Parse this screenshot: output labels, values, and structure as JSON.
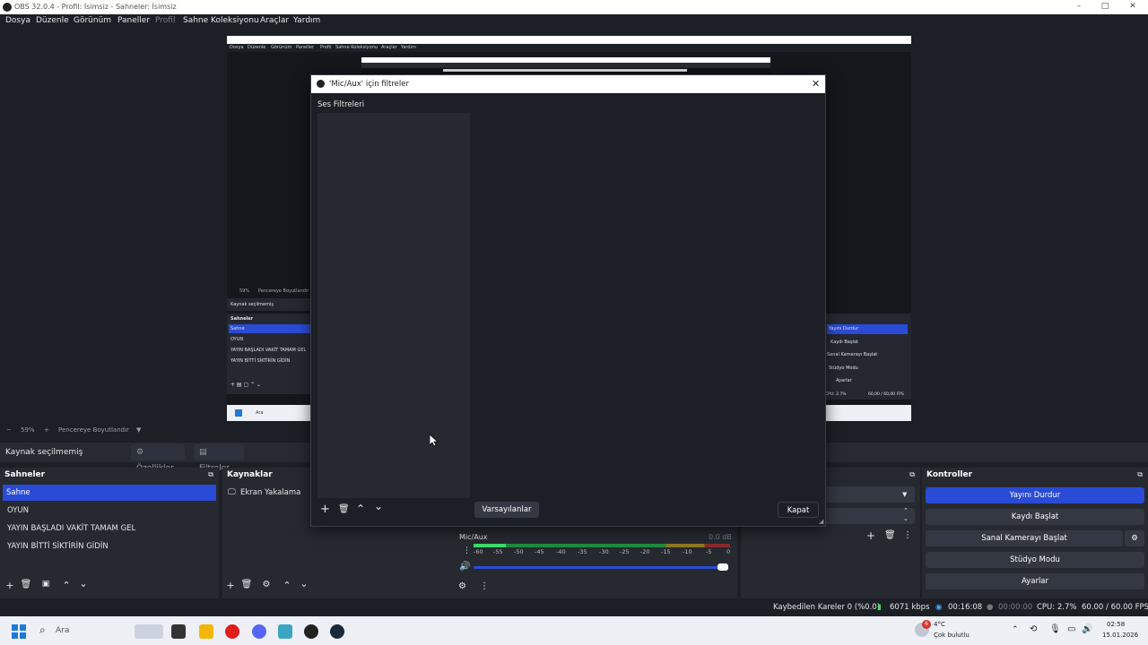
{
  "window": {
    "title": "OBS 32.0.4 - Profil: İsimsiz - Sahneler: İsimsiz"
  },
  "menu": [
    "Dosya",
    "Düzenle",
    "Görünüm",
    "Paneller",
    "Profil",
    "Sahne Koleksiyonu",
    "Araçlar",
    "Yardım"
  ],
  "preview": {
    "nested_menu": [
      "Dosya",
      "Düzenle",
      "Görünüm",
      "Paneller",
      "Profil",
      "Sahne Koleksiyonu",
      "Araçlar",
      "Yardım"
    ],
    "nested_zoom": "59%",
    "nested_fit": "Pencereye Boyutlandır",
    "nested_source": "Kaynak seçilmemiş",
    "nested_scenes_title": "Sahneler",
    "nested_scenes": [
      "Sahne",
      "OYUN",
      "YAYIN BAŞLADI VAKİT TAMAM GEL",
      "YAYIN BİTTİ SİKTİRİN GİDİN"
    ],
    "nested_controls": [
      "Yayını Durdur",
      "Kaydı Başlat",
      "Sanal Kamerayı Başlat",
      "Stüdyo Modu",
      "Ayarlar"
    ],
    "nested_status": "CPU: 2.7%",
    "nested_fps": "60,00 / 60,00 FPS",
    "nested_search": "Ara"
  },
  "zoom": {
    "minus": "−",
    "value": "59%",
    "plus": "+",
    "fit_label": "Pencereye Boyutlandır"
  },
  "context": {
    "no_source": "Kaynak seçilmemiş",
    "properties": "Özellikler",
    "filters": "Filtreler"
  },
  "scenes": {
    "title": "Sahneler",
    "items": [
      "Sahne",
      "OYUN",
      "YAYIN BAŞLADI VAKİT TAMAM GEL",
      "YAYIN BİTTİ SİKTİRİN GİDİN"
    ],
    "selected": 0
  },
  "sources": {
    "title": "Kaynaklar",
    "items": [
      "Ekran Yakalama"
    ]
  },
  "mixer": {
    "channel": "Mic/Aux",
    "db": "0.0 dB",
    "ticks": [
      "-60",
      "-55",
      "-50",
      "-45",
      "-40",
      "-35",
      "-30",
      "-25",
      "-20",
      "-15",
      "-10",
      "-5",
      "0"
    ],
    "volume": 1.0
  },
  "controls": {
    "title": "Kontroller",
    "buttons": [
      "Yayını Durdur",
      "Kaydı Başlat",
      "Sanal Kamerayı Başlat",
      "Stüdyo Modu",
      "Ayarlar"
    ]
  },
  "status": {
    "dropped": "Kaybedilen Kareler 0 (%0.0)",
    "bitrate": "6071 kbps",
    "stream_time": "00:16:08",
    "rec_time": "00:00:00",
    "cpu": "CPU: 2.7%",
    "fps": "60.00 / 60.00 FPS"
  },
  "dialog": {
    "title": "'Mic/Aux' için filtreler",
    "section": "Ses Filtreleri",
    "defaults_btn": "Varsayılanlar",
    "close_btn": "Kapat"
  },
  "taskbar": {
    "search": "Ara",
    "temp": "4°C",
    "weather": "Çok bulutlu",
    "time": "02:58",
    "date": "15.01.2026",
    "notif_count": "6"
  },
  "colors": {
    "accent": "#2a4bd6",
    "panel": "#262930",
    "background": "#1d1f26"
  }
}
